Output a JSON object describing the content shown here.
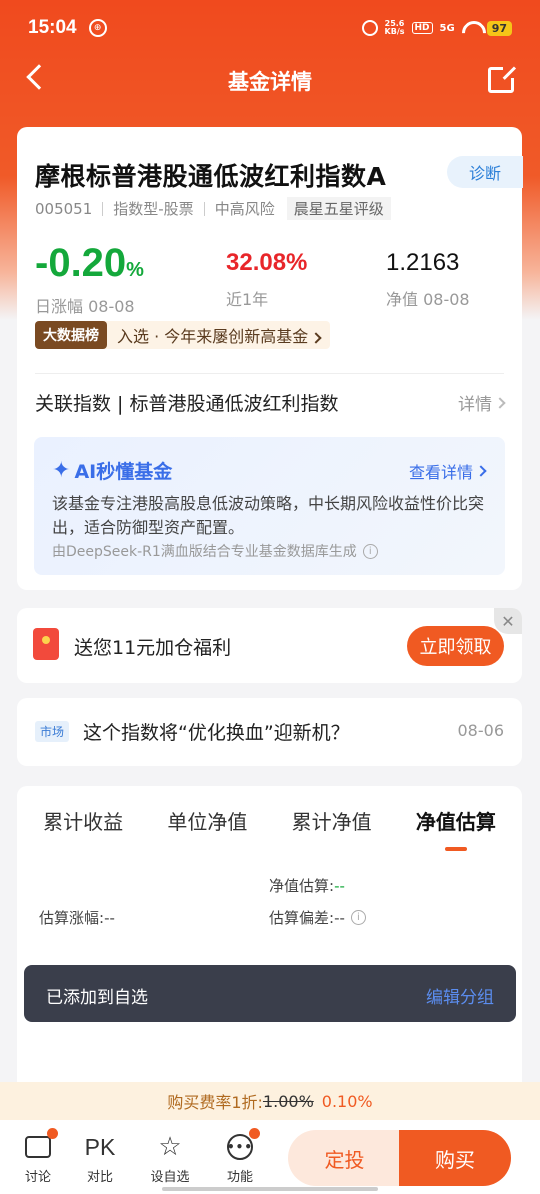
{
  "status_bar": {
    "time": "15:04",
    "speed_value": "25.6",
    "speed_unit": "KB/s",
    "hd": "HD",
    "signal": "5G",
    "battery": "97"
  },
  "nav": {
    "title": "基金详情"
  },
  "fund": {
    "name": "摩根标普港股通低波红利指数A",
    "diagnose_label": "诊断",
    "code": "005051",
    "type": "指数型-股票",
    "risk": "中高风险",
    "rating": "晨星五星评级",
    "daily_change": "-0.20",
    "daily_change_unit": "%",
    "daily_change_label": "日涨幅 08-08",
    "one_year_return": "32.08%",
    "one_year_label": "近1年",
    "nav_value": "1.2163",
    "nav_label": "净值 08-08",
    "bigdata_badge": "大数据榜",
    "bigdata_text": "入选 · 今年来屡创新高基金",
    "related_index": "关联指数 | 标普港股通低波红利指数",
    "related_detail": "详情"
  },
  "ai": {
    "title": "AI秒懂基金",
    "link": "查看详情",
    "description": "该基金专注港股高股息低波动策略，中长期风险收益性价比突出，适合防御型资产配置。",
    "source": "由DeepSeek-R1满血版结合专业基金数据库生成"
  },
  "promo": {
    "text": "送您11元加仓福利",
    "button": "立即领取",
    "close": "✕"
  },
  "news": {
    "badge": "市场",
    "title": "这个指数将“优化换血”迎新机？",
    "date": "08-06"
  },
  "tabs": {
    "items": [
      {
        "label": "累计收益"
      },
      {
        "label": "单位净值"
      },
      {
        "label": "累计净值"
      },
      {
        "label": "净值估算"
      }
    ],
    "active_index": 3
  },
  "estimate": {
    "nav_est_label": "净值估算:",
    "nav_est_value": "--",
    "change_label": "估算涨幅:",
    "change_value": "--",
    "deviation_label": "估算偏差:",
    "deviation_value": "--"
  },
  "toast": {
    "text": "已添加到自选",
    "link": "编辑分组"
  },
  "fee": {
    "label": "购买费率1折:",
    "old": "1.00%",
    "new": "0.10%"
  },
  "bottom_bar": {
    "discuss": "讨论",
    "compare_icon": "PK",
    "compare": "对比",
    "watchlist": "设自选",
    "functions": "功能",
    "sip": "定投",
    "buy": "购买"
  },
  "colors": {
    "brand": "#f05a22",
    "up": "#e8262a",
    "down": "#14a83b",
    "ai_blue": "#3a6ee8"
  }
}
